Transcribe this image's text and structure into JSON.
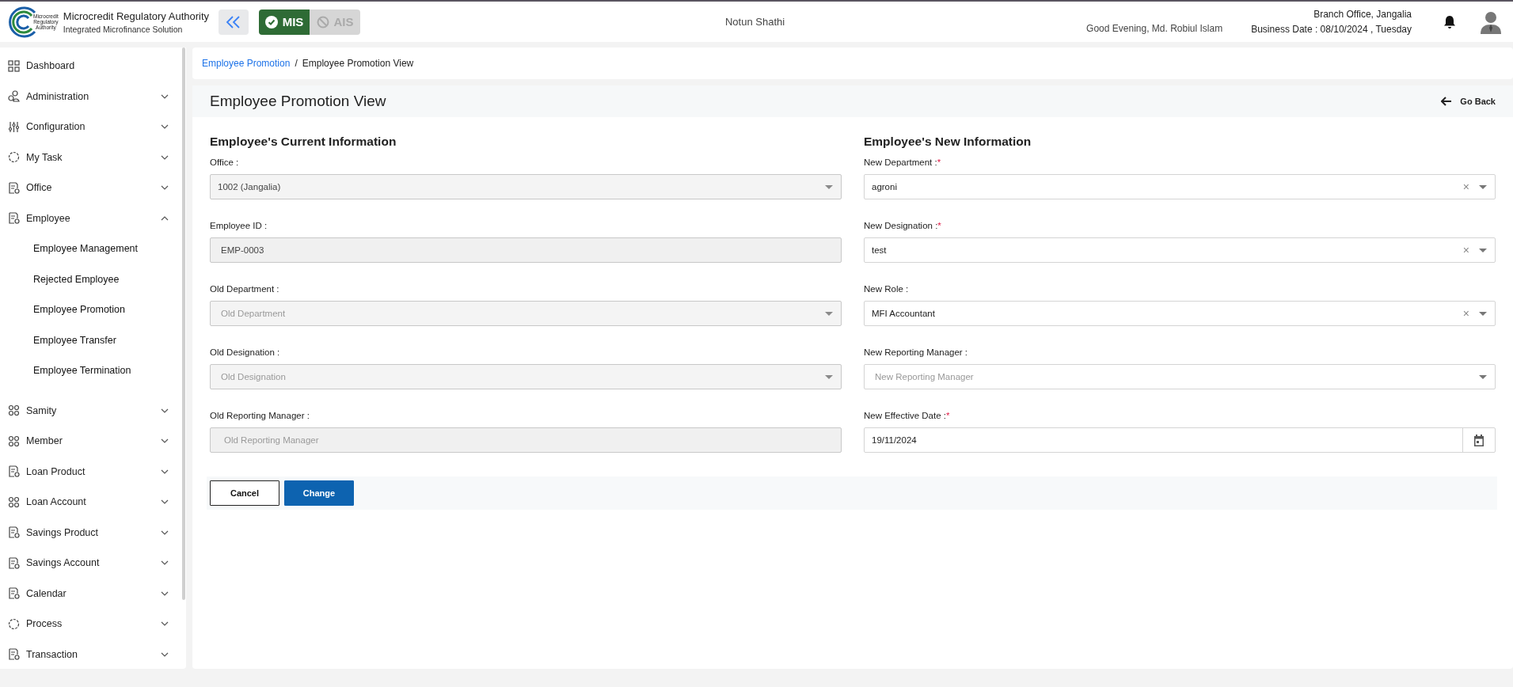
{
  "header": {
    "org_title": "Microcredit Regulatory Authority",
    "org_subtitle": "Integrated Microfinance Solution",
    "logo_text": [
      "Microcredit",
      "Regulatory",
      "Authority"
    ],
    "modules": [
      {
        "label": "MIS",
        "selected": true
      },
      {
        "label": "AIS",
        "selected": false
      }
    ],
    "app_name": "Notun Shathi",
    "greeting": "Good Evening, Md. Robiul Islam",
    "branch": "Branch Office, Jangalia",
    "business_date": "Business Date : 08/10/2024 , Tuesday"
  },
  "sidebar": {
    "items": [
      {
        "label": "Dashboard",
        "kind": "link"
      },
      {
        "label": "Administration",
        "kind": "group",
        "expanded": false
      },
      {
        "label": "Configuration",
        "kind": "group",
        "expanded": false
      },
      {
        "label": "My Task",
        "kind": "group",
        "expanded": false
      },
      {
        "label": "Office",
        "kind": "group",
        "expanded": false
      },
      {
        "label": "Employee",
        "kind": "group",
        "expanded": true,
        "children": [
          {
            "label": "Employee Management"
          },
          {
            "label": "Rejected Employee"
          },
          {
            "label": "Employee Promotion"
          },
          {
            "label": "Employee Transfer"
          },
          {
            "label": "Employee Termination"
          }
        ]
      },
      {
        "label": "Samity",
        "kind": "group",
        "expanded": false
      },
      {
        "label": "Member",
        "kind": "group",
        "expanded": false
      },
      {
        "label": "Loan Product",
        "kind": "group",
        "expanded": false
      },
      {
        "label": "Loan Account",
        "kind": "group",
        "expanded": false
      },
      {
        "label": "Savings Product",
        "kind": "group",
        "expanded": false
      },
      {
        "label": "Savings Account",
        "kind": "group",
        "expanded": false
      },
      {
        "label": "Calendar",
        "kind": "group",
        "expanded": false
      },
      {
        "label": "Process",
        "kind": "group",
        "expanded": false
      },
      {
        "label": "Transaction",
        "kind": "group",
        "expanded": false
      }
    ]
  },
  "breadcrumb": [
    {
      "label": "Employee Promotion",
      "kind": "link"
    },
    {
      "label": "/",
      "kind": "separator"
    },
    {
      "label": "Employee Promotion View",
      "kind": "current"
    }
  ],
  "page": {
    "title": "Employee Promotion View",
    "go_back": "Go Back"
  },
  "sections": [
    {
      "title": "Employee's Current Information",
      "fields": [
        {
          "label": "Office :",
          "required": false,
          "kind": "select",
          "value": "1002 (Jangalia)",
          "disabled": true,
          "clearable": false
        },
        {
          "label": "Employee ID :",
          "required": false,
          "kind": "input",
          "value": "EMP-0003",
          "disabled": true,
          "clearable": false
        },
        {
          "label": "Old Department :",
          "required": false,
          "kind": "select",
          "placeholder": "Old Department",
          "disabled": true,
          "clearable": false
        },
        {
          "label": "Old Designation :",
          "required": false,
          "kind": "select",
          "placeholder": "Old Designation",
          "disabled": true,
          "clearable": false
        },
        {
          "label": "Old Reporting Manager :",
          "required": false,
          "kind": "input",
          "placeholder": "Old Reporting Manager",
          "disabled": true,
          "clearable": false
        }
      ]
    },
    {
      "title": "Employee's New Information",
      "fields": [
        {
          "label": "New Department :",
          "required": true,
          "kind": "select",
          "value": "agroni",
          "disabled": false,
          "clearable": true
        },
        {
          "label": "New Designation :",
          "required": true,
          "kind": "select",
          "value": "test",
          "disabled": false,
          "clearable": true
        },
        {
          "label": "New Role :",
          "required": false,
          "kind": "select",
          "value": "MFI Accountant",
          "disabled": false,
          "clearable": true
        },
        {
          "label": "New Reporting Manager :",
          "required": false,
          "kind": "select",
          "placeholder": "New Reporting Manager",
          "disabled": false,
          "clearable": false
        },
        {
          "label": "New Effective Date :",
          "required": true,
          "kind": "date",
          "value": "19/11/2024",
          "disabled": false,
          "clearable": false
        }
      ]
    }
  ],
  "required_mark": "*",
  "clear_mark": "×",
  "buttons": [
    {
      "label": "Cancel",
      "kind": "secondary"
    },
    {
      "label": "Change",
      "kind": "primary"
    }
  ]
}
